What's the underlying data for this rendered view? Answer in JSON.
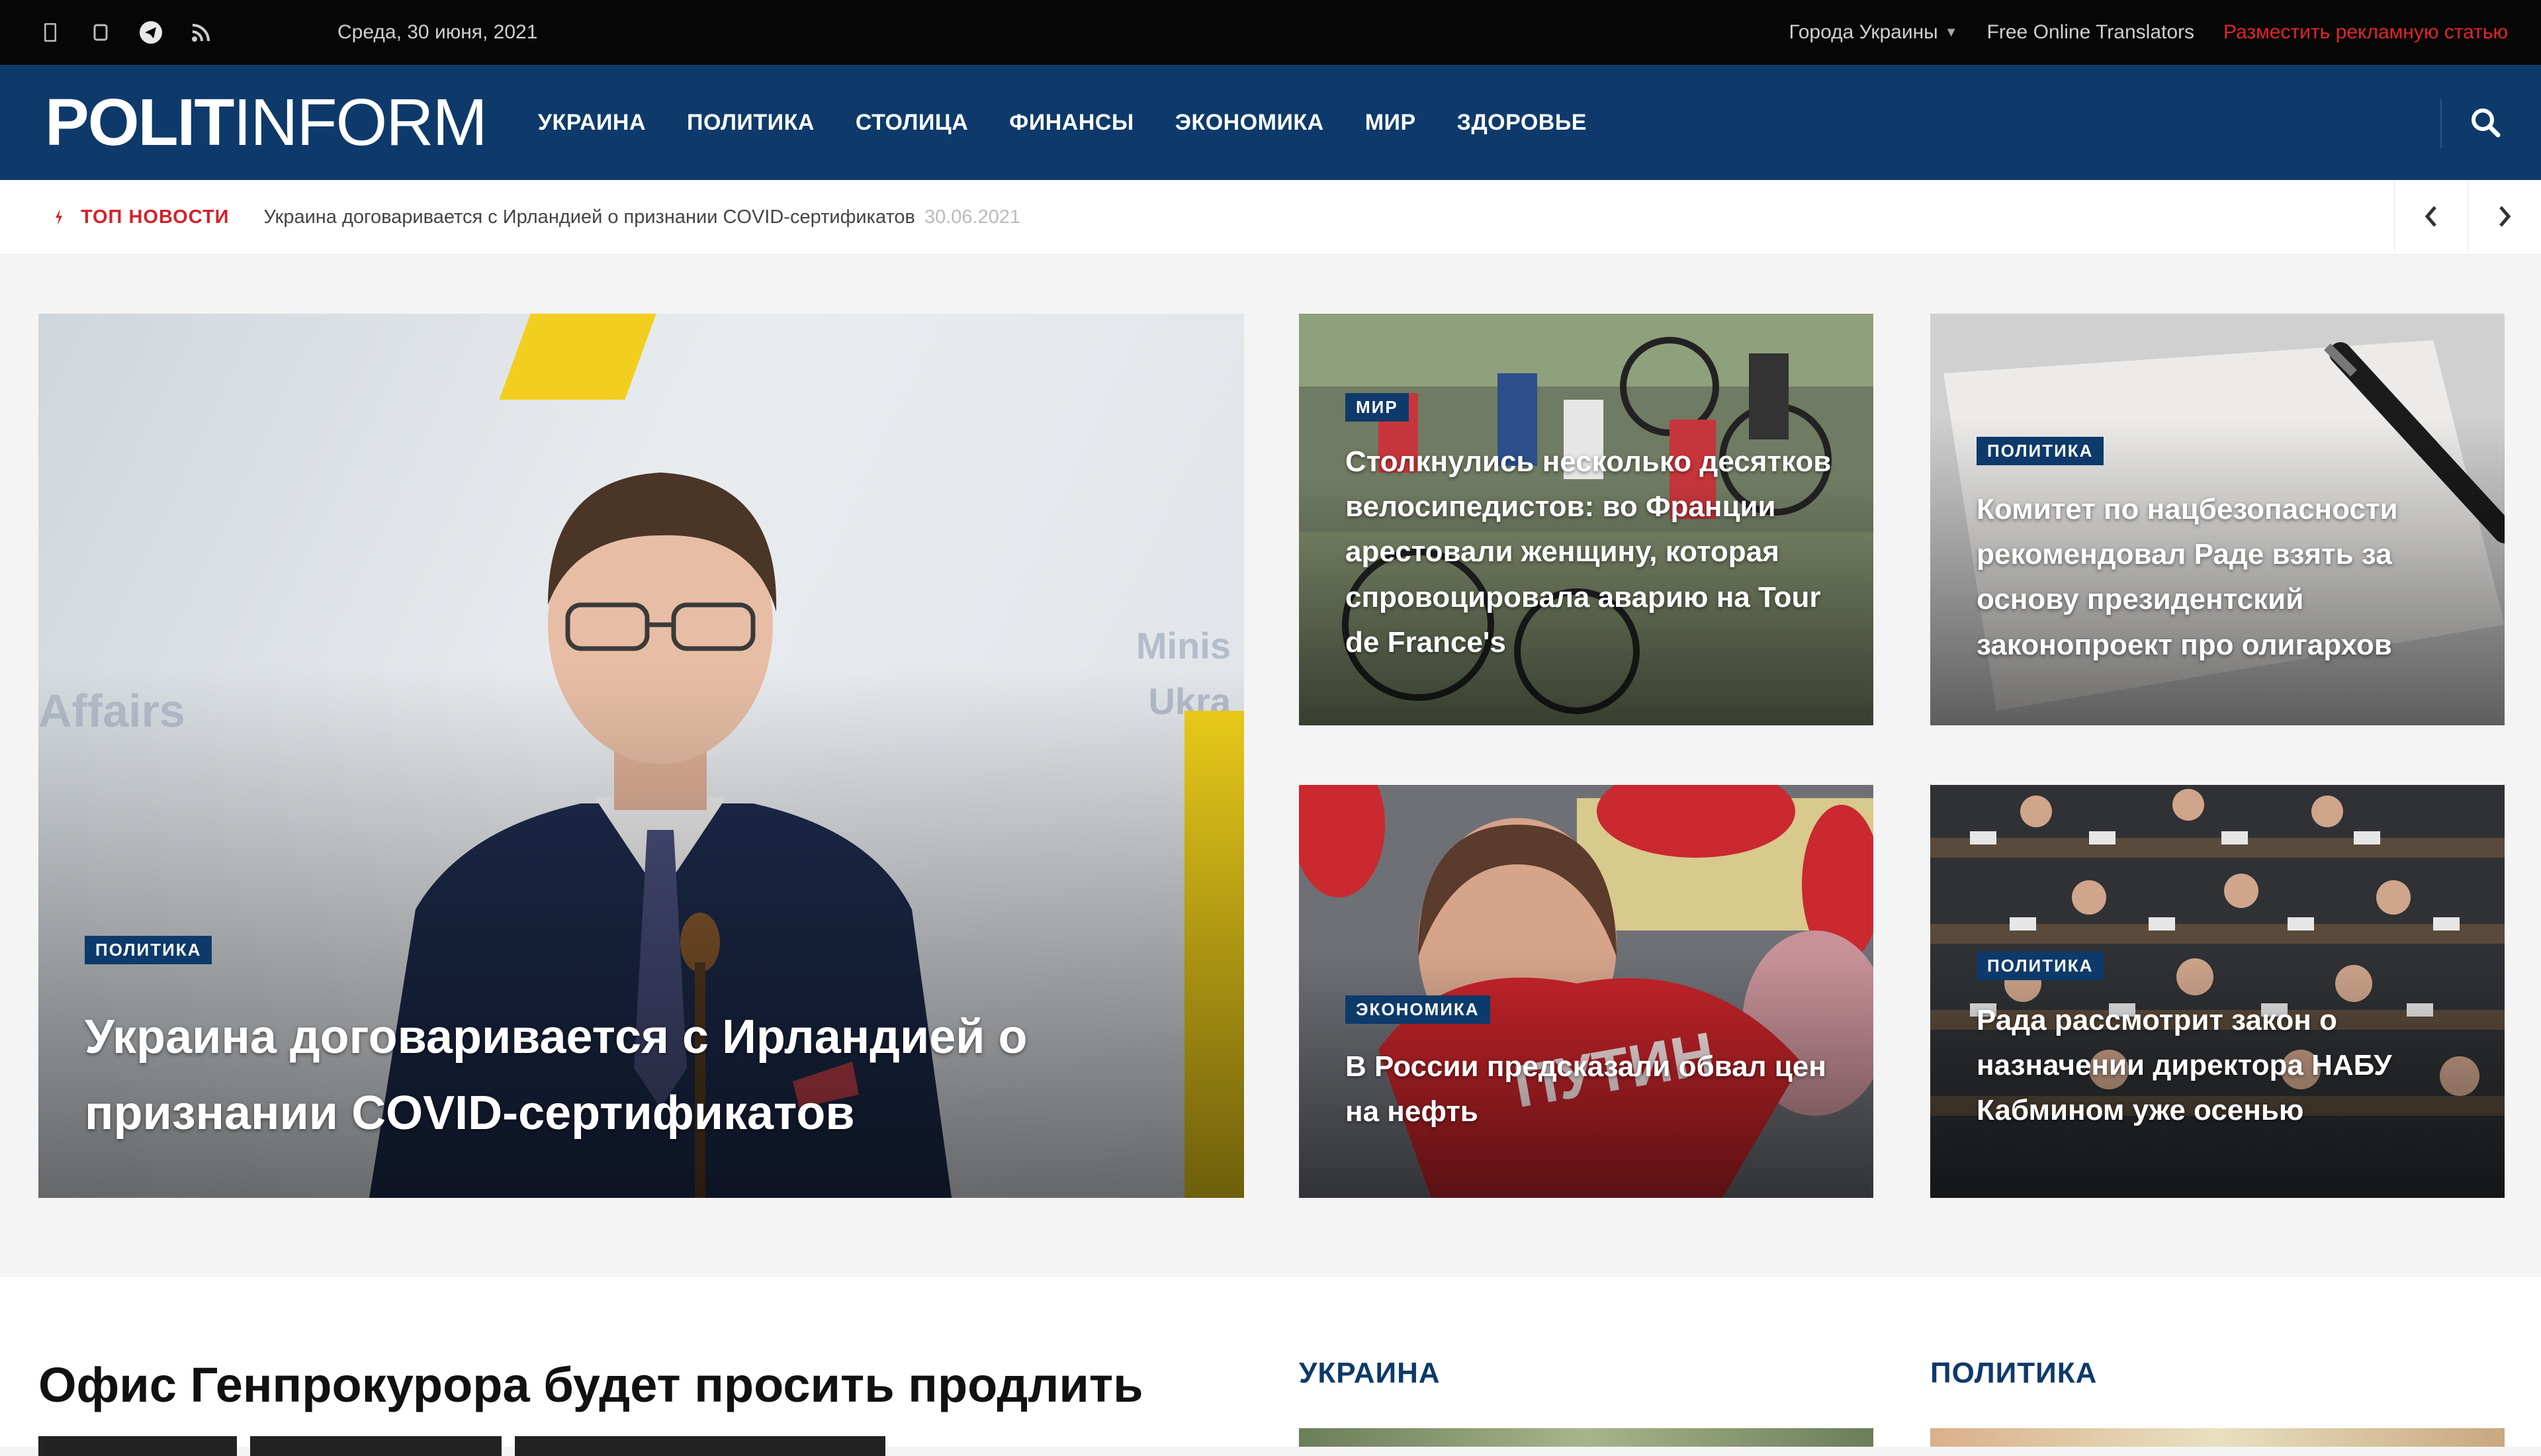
{
  "topbar": {
    "social_icons": [
      "facebook-icon",
      "instagram-icon",
      "telegram-icon",
      "rss-icon"
    ],
    "date": "Среда, 30 июня, 2021",
    "links": {
      "cities": "Города Украины",
      "translators": "Free Online Translators",
      "advertise": "Разместить рекламную статью"
    }
  },
  "header": {
    "logo_bold": "POLIT",
    "logo_regular": "INFORM",
    "nav": [
      "УКРАИНА",
      "ПОЛИТИКА",
      "СТОЛИЦА",
      "ФИНАНСЫ",
      "ЭКОНОМИКА",
      "МИР",
      "ЗДОРОВЬЕ"
    ]
  },
  "ticker": {
    "label": "ТОП НОВОСТИ",
    "text": "Украина договаривается с Ирландией о признании COVID-сертификатов",
    "time": "30.06.2021"
  },
  "featured": {
    "main": {
      "category": "ПОЛИТИКА",
      "title": "Украина договаривается с Ирландией о признании COVID-сертификатов"
    },
    "r1": {
      "category": "МИР",
      "title": "Столкнулись несколько десятков велосипедистов: во Франции арестовали женщину, которая спровоцировала аварию на Tour de France's"
    },
    "r2": {
      "category": "ПОЛИТИКА",
      "title": "Комитет по нацбезопасности рекомендовал Раде взять за основу президентский законопроект про олигархов"
    },
    "r3": {
      "category": "ЭКОНОМИКА",
      "title": "В России предсказали обвал цен на нефть"
    },
    "r4": {
      "category": "ПОЛИТИКА",
      "title": "Рада рассмотрит закон о назначении директора НАБУ Кабмином уже осенью"
    }
  },
  "lower": {
    "headline": "Офис Генпрокурора будет просить продлить",
    "section_ukraine": "УКРАИНА",
    "section_politics": "ПОЛИТИКА"
  }
}
